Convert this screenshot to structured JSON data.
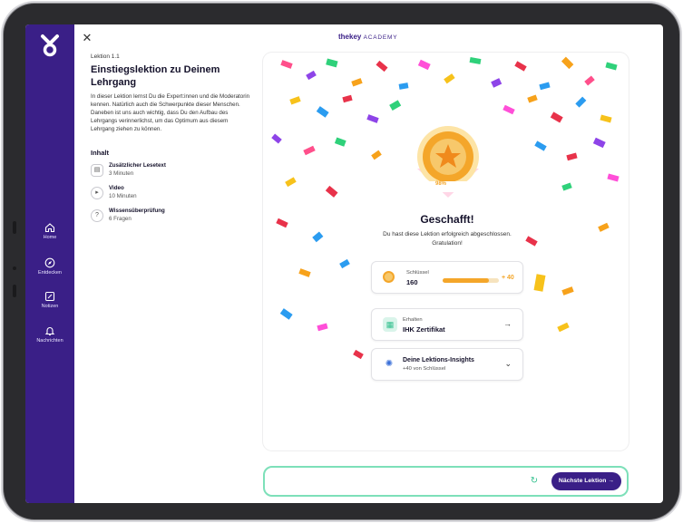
{
  "brand": {
    "name": "thekey",
    "suffix": "ACADEMY"
  },
  "sidebar": {
    "items": [
      {
        "label": "Home",
        "icon": "home-icon"
      },
      {
        "label": "Entdecken",
        "icon": "compass-icon"
      },
      {
        "label": "Notizen",
        "icon": "notes-icon"
      },
      {
        "label": "Nachrichten",
        "icon": "bell-icon"
      }
    ]
  },
  "lesson": {
    "kicker": "Lektion 1.1",
    "title": "Einstiegslektion zu Deinem Lehrgang",
    "description": "In dieser Lektion lernst Du die Expert:innen und die Moderatorin kennen. Natürlich auch die Schwerpunkte dieser Menschen. Daneben ist uns auch wichtig, dass Du den Aufbau des Lehrgangs verinnerlichst, um das Optimum aus diesem Lehrgang ziehen zu können.",
    "content_heading": "Inhalt",
    "contents": [
      {
        "title": "Zusätzlicher Lesetext",
        "sub": "3 Minuten",
        "icon": "reading-icon"
      },
      {
        "title": "Video",
        "sub": "10 Minuten",
        "icon": "play-icon"
      },
      {
        "title": "Wissensüberprüfung",
        "sub": "6 Fragen",
        "icon": "quiz-icon"
      }
    ]
  },
  "completion": {
    "badge_percent": "98%",
    "title": "Geschafft!",
    "subtitle": "Du hast diese Lektion erfolgreich abgeschlossen. Gratulation!",
    "keys": {
      "caption": "Schlüssel",
      "value": "160",
      "gain": "+ 40",
      "progress": 0.82
    },
    "certificate": {
      "caption": "Erhalten",
      "value": "IHK Zertifikat"
    },
    "insights": {
      "title": "Deine Lektions-Insights",
      "sub": "+40 von Schlüssel"
    }
  },
  "footer": {
    "next_label": "Nächste Lektion"
  },
  "colors": {
    "brand": "#3a1f87",
    "accent": "#f4a62a",
    "mint": "#7de0b9"
  }
}
